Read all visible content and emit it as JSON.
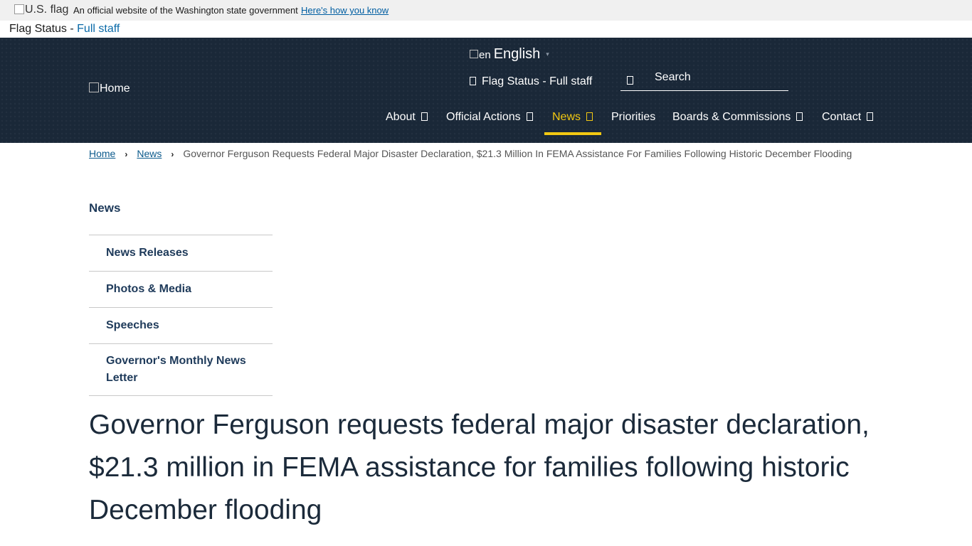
{
  "gov_banner": {
    "flag_alt": "U.S. flag",
    "official_text": "An official website of the Washington state government",
    "how_link": "Here's how you know"
  },
  "flag_status": {
    "label": "Flag Status - ",
    "value": "Full staff"
  },
  "header": {
    "home_alt": "Home",
    "language": {
      "code_alt": "en",
      "label": "English",
      "caret": "▾"
    },
    "flag_status_text": "Flag Status - Full staff",
    "search_placeholder": "Search",
    "nav": [
      {
        "label": "About",
        "has_dropdown": true
      },
      {
        "label": "Official Actions",
        "has_dropdown": true
      },
      {
        "label": "News",
        "has_dropdown": true,
        "active": true
      },
      {
        "label": "Priorities",
        "has_dropdown": false
      },
      {
        "label": "Boards & Commissions",
        "has_dropdown": true
      },
      {
        "label": "Contact",
        "has_dropdown": true
      }
    ],
    "accent_color": "#f2c812",
    "background_color": "#1a2838"
  },
  "breadcrumb": {
    "items": [
      "Home",
      "News"
    ],
    "separator": "›",
    "current": "Governor Ferguson Requests Federal Major Disaster Declaration, $21.3 Million In FEMA Assistance For Families Following Historic December Flooding"
  },
  "sidebar": {
    "title": "News",
    "items": [
      {
        "label": "News Releases"
      },
      {
        "label": "Photos & Media"
      },
      {
        "label": "Speeches"
      },
      {
        "label": "Governor's Monthly News Letter"
      }
    ]
  },
  "article": {
    "headline": "Governor Ferguson requests federal major disaster declaration, $21.3 million in FEMA assistance for families following historic December flooding"
  }
}
